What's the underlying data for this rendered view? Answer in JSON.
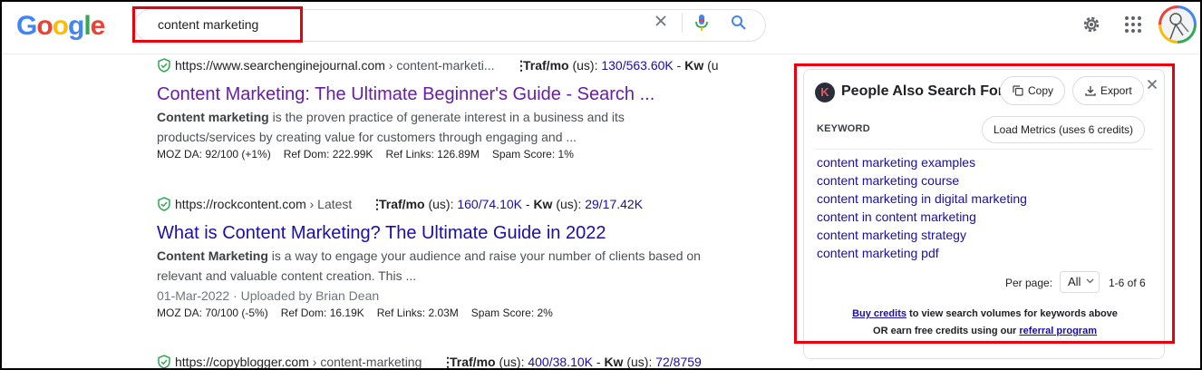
{
  "logo": {
    "letters": [
      "G",
      "o",
      "o",
      "g",
      "l",
      "e"
    ],
    "colors": [
      "#4285f4",
      "#ea4335",
      "#fbbc05",
      "#4285f4",
      "#34a853",
      "#ea4335"
    ]
  },
  "search": {
    "query": "content marketing"
  },
  "results": [
    {
      "url_host": "https://www.searchenginejournal.com",
      "url_path": " › content-marketi...",
      "traf_label": "Traf/mo",
      "traf_us": " (us): ",
      "traf_value": "130/563.60K",
      "kw_label": "Kw",
      "kw_value": " (u",
      "title": "Content Marketing: The Ultimate Beginner's Guide - Search ...",
      "snippet_bold": "Content marketing",
      "snippet_rest": " is the proven practice of generate interest in a business and its products/services by creating value for customers through engaging and ...",
      "metrics": [
        "MOZ DA: 92/100 (+1%)",
        "Ref Dom: 222.99K",
        "Ref Links: 126.89M",
        "Spam Score: 1%"
      ]
    },
    {
      "url_host": "https://rockcontent.com",
      "url_path": " › Latest",
      "traf_label": "Traf/mo",
      "traf_us": " (us): ",
      "traf_value": "160/74.10K",
      "kw_label": "Kw",
      "kw_sep": " (us): ",
      "kw_value": "29/17.42K",
      "title": "What is Content Marketing? The Ultimate Guide in 2022",
      "snippet_bold": "Content Marketing",
      "snippet_rest": " is a way to engage your audience and raise your number of clients based on relevant and valuable content creation. This ...",
      "date": "01-Mar-2022 · Uploaded by Brian Dean",
      "metrics": [
        "MOZ DA: 70/100 (-5%)",
        "Ref Dom: 16.19K",
        "Ref Links: 2.03M",
        "Spam Score: 2%"
      ]
    },
    {
      "url_host": "https://copyblogger.com",
      "url_path": " › content-marketing",
      "traf_label": "Traf/mo",
      "traf_us": " (us): ",
      "traf_value": "400/38.10K",
      "kw_label": "Kw",
      "kw_sep": " (us): ",
      "kw_value": "72/8759"
    }
  ],
  "panel": {
    "title": "People Also Search For",
    "logo_letter": "K",
    "copy_label": "Copy",
    "export_label": "Export",
    "keyword_header": "KEYWORD",
    "load_metrics_label": "Load Metrics (uses 6 credits)",
    "keywords": [
      "content marketing examples",
      "content marketing course",
      "content marketing in digital marketing",
      "content in content marketing",
      "content marketing strategy",
      "content marketing pdf"
    ],
    "per_page_label": "Per page:",
    "per_page_value": "All",
    "range": "1-6 of 6",
    "footer_link1": "Buy credits",
    "footer_text1": " to view search volumes for keywords above",
    "footer_text2": "OR earn free credits using our ",
    "footer_link2": "referral program"
  },
  "colors": {
    "highlight": "#e8000d",
    "link": "#1a0dab",
    "visited": "#681da8"
  }
}
